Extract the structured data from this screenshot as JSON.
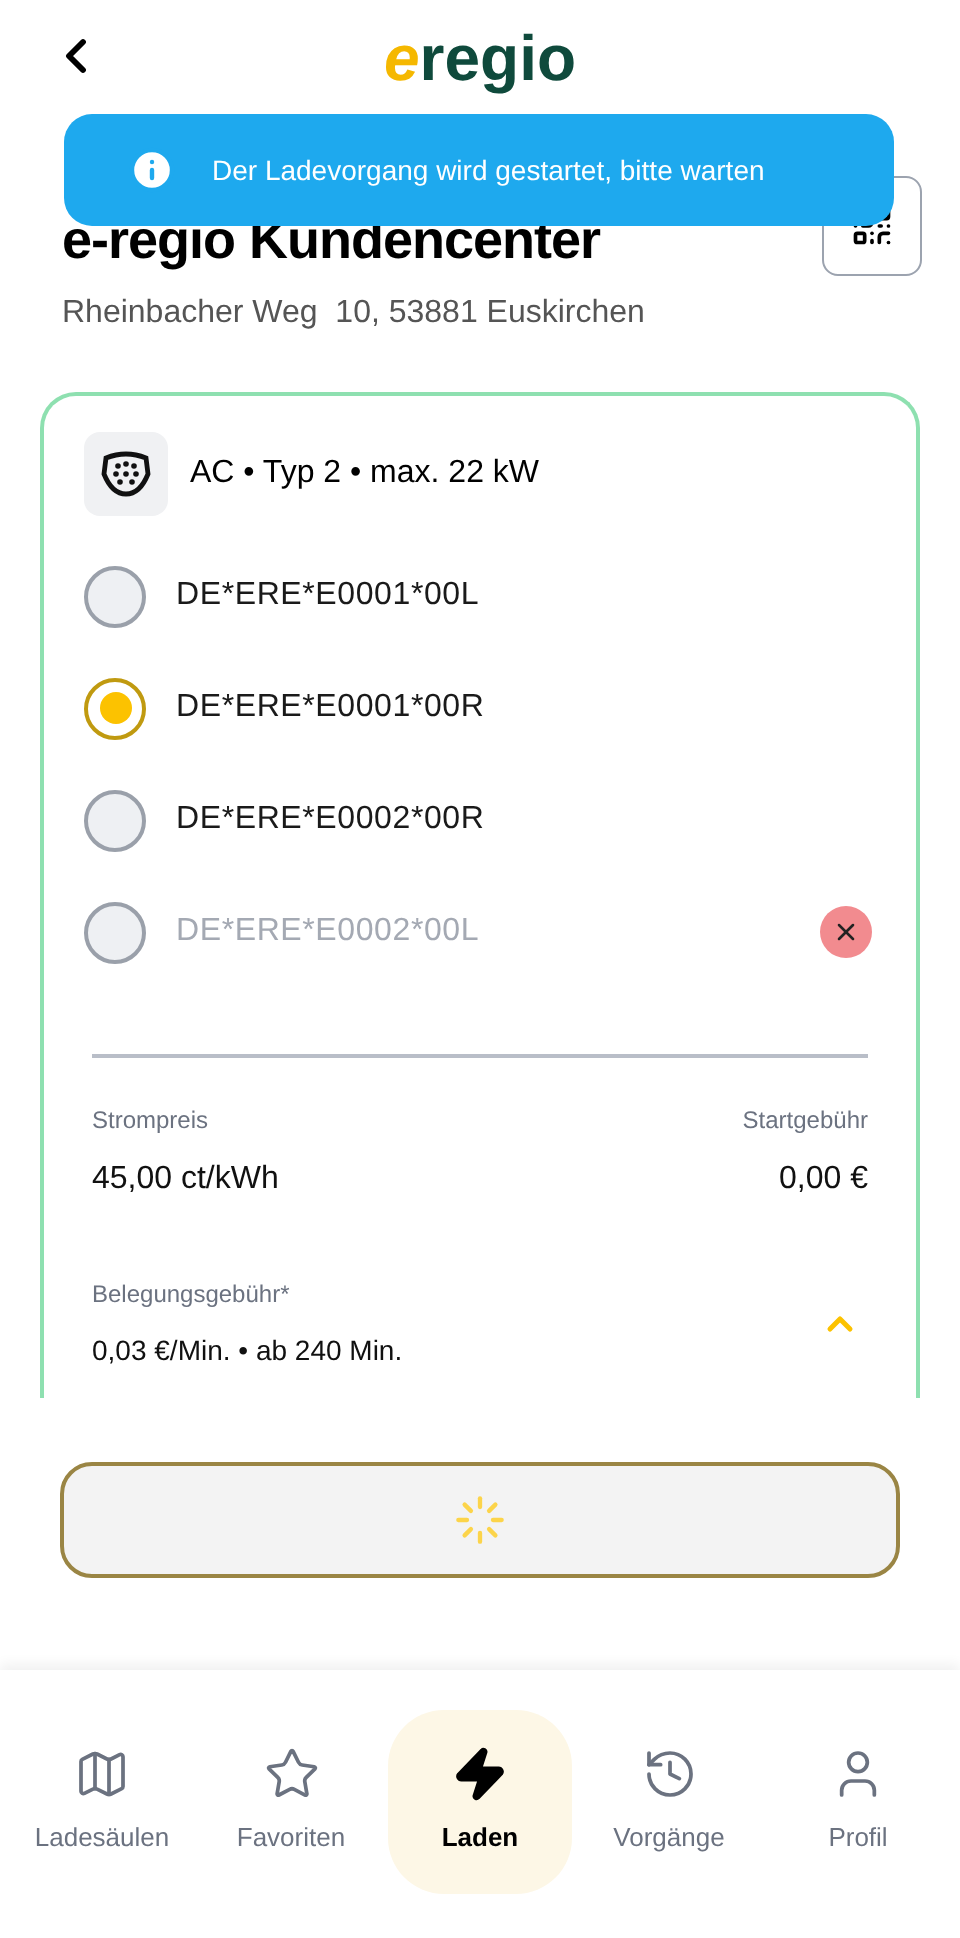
{
  "header": {
    "logo_mark": "e",
    "logo_text": "regio"
  },
  "toast": {
    "message": "Der Ladevorgang wird gestartet, bitte warten"
  },
  "station": {
    "title": "e-regio Kundencenter",
    "address": "Rheinbacher Weg  10, 53881 Euskirchen"
  },
  "connector": {
    "label": "AC • Typ 2 • max. 22 kW"
  },
  "evses": [
    {
      "id": "DE*ERE*E0001*00L",
      "selected": false,
      "disabled": false
    },
    {
      "id": "DE*ERE*E0001*00R",
      "selected": true,
      "disabled": false
    },
    {
      "id": "DE*ERE*E0002*00R",
      "selected": false,
      "disabled": false
    },
    {
      "id": "DE*ERE*E0002*00L",
      "selected": false,
      "disabled": true
    }
  ],
  "prices": {
    "energy_label": "Strompreis",
    "energy_value": "45,00 ct/kWh",
    "start_label": "Startgebühr",
    "start_value": "0,00 €",
    "blocking_label": "Belegungsgebühr*",
    "blocking_value": "0,03 €/Min. • ab 240 Min.",
    "expanded": true
  },
  "nav": [
    {
      "kind": "map",
      "label": "Ladesäulen",
      "selected": false
    },
    {
      "kind": "star",
      "label": "Favoriten",
      "selected": false
    },
    {
      "kind": "bolt",
      "label": "Laden",
      "selected": true
    },
    {
      "kind": "history",
      "label": "Vorgänge",
      "selected": false
    },
    {
      "kind": "user",
      "label": "Profil",
      "selected": false
    }
  ]
}
